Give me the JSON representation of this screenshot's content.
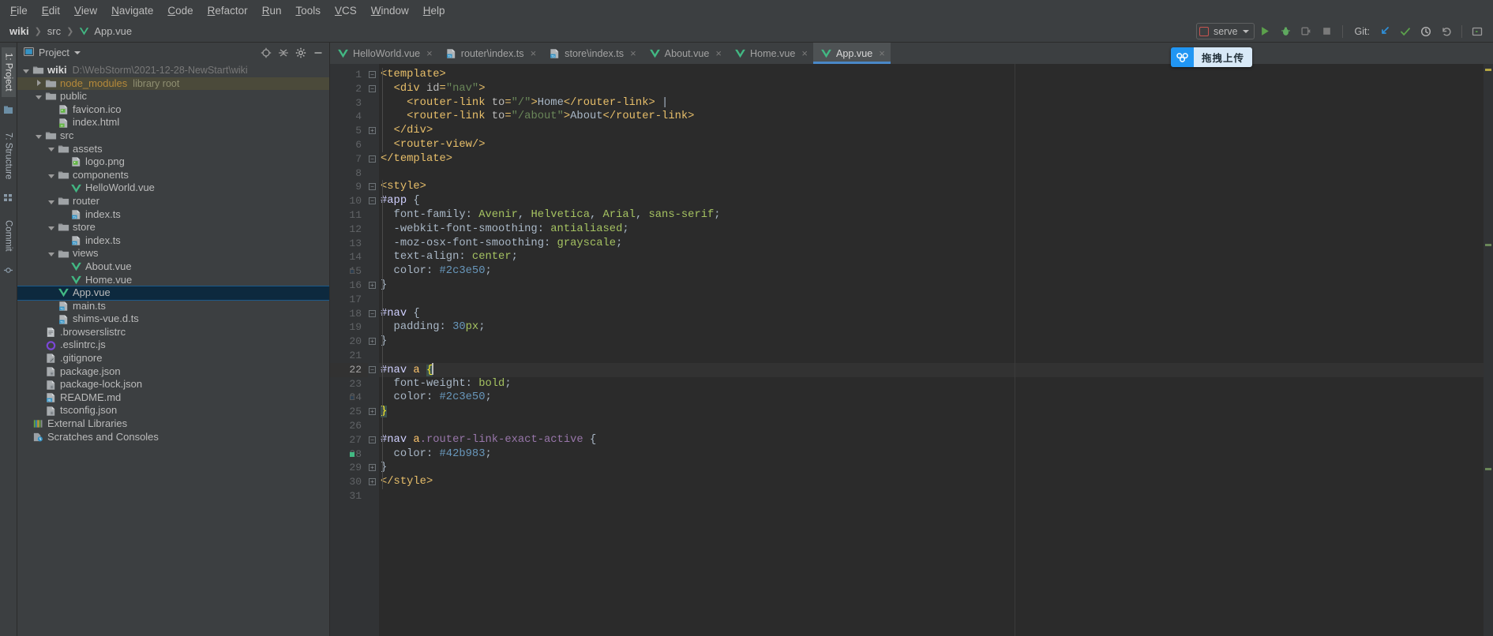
{
  "menubar": {
    "items": [
      "File",
      "Edit",
      "View",
      "Navigate",
      "Code",
      "Refactor",
      "Run",
      "Tools",
      "VCS",
      "Window",
      "Help"
    ]
  },
  "navbar": {
    "breadcrumb": [
      "wiki",
      "src",
      "App.vue"
    ],
    "breadcrumb_file_icon": "vue-icon",
    "run_config": {
      "label": "serve",
      "icon": "vue-config-icon",
      "dropdown_icon": "chevron-down-icon"
    },
    "actions": [
      {
        "name": "run-button",
        "icon": "play-icon",
        "color": "#5ca14c"
      },
      {
        "name": "debug-button",
        "icon": "bug-icon",
        "color": "#5fa95f"
      },
      {
        "name": "run-coverage-button",
        "icon": "coverage-icon",
        "color": "#7a7a7a"
      },
      {
        "name": "stop-button",
        "icon": "stop-icon",
        "color": "#7a7a7a"
      }
    ],
    "git_label": "Git:",
    "git_actions": [
      {
        "name": "update-project-button",
        "icon": "arrow-down-left-icon",
        "color": "#2f8fd6"
      },
      {
        "name": "commit-button",
        "icon": "check-icon",
        "color": "#5ca14c"
      },
      {
        "name": "history-button",
        "icon": "clock-icon",
        "color": "#b3b3b3"
      },
      {
        "name": "rollback-button",
        "icon": "undo-icon",
        "color": "#9a9a9a"
      }
    ],
    "search_everywhere_icon": "search-icon"
  },
  "left_rail": {
    "tabs": [
      {
        "label": "1: Project",
        "active": true,
        "icon": "project-icon"
      },
      {
        "label": "7: Structure",
        "active": false,
        "icon": "structure-icon"
      },
      {
        "label": "Commit",
        "active": false,
        "icon": "commit-icon"
      }
    ]
  },
  "project_panel": {
    "title": "Project",
    "dropdown_icon": "chevron-down-icon",
    "actions": [
      {
        "name": "select-opened-file-button",
        "icon": "target-icon"
      },
      {
        "name": "collapse-all-button",
        "icon": "collapse-icon"
      },
      {
        "name": "settings-button",
        "icon": "gear-icon"
      },
      {
        "name": "hide-button",
        "icon": "minus-icon"
      }
    ],
    "tree": [
      {
        "depth": 0,
        "arrow": "down",
        "icon": "folder-icon",
        "label": "wiki",
        "bold": true,
        "sub": "D:\\WebStorm\\2021-12-28-NewStart\\wiki"
      },
      {
        "depth": 1,
        "arrow": "right",
        "icon": "folder-icon",
        "label": "node_modules",
        "lib": true,
        "sub": "library root",
        "highlighted": true
      },
      {
        "depth": 1,
        "arrow": "down",
        "icon": "folder-icon",
        "label": "public"
      },
      {
        "depth": 2,
        "arrow": "none",
        "icon": "image-file-icon",
        "label": "favicon.ico"
      },
      {
        "depth": 2,
        "arrow": "none",
        "icon": "html-file-icon",
        "label": "index.html"
      },
      {
        "depth": 1,
        "arrow": "down",
        "icon": "folder-icon",
        "label": "src"
      },
      {
        "depth": 2,
        "arrow": "down",
        "icon": "folder-icon",
        "label": "assets"
      },
      {
        "depth": 3,
        "arrow": "none",
        "icon": "image-file-icon",
        "label": "logo.png"
      },
      {
        "depth": 2,
        "arrow": "down",
        "icon": "folder-icon",
        "label": "components"
      },
      {
        "depth": 3,
        "arrow": "none",
        "icon": "vue-file-icon",
        "label": "HelloWorld.vue"
      },
      {
        "depth": 2,
        "arrow": "down",
        "icon": "folder-icon",
        "label": "router"
      },
      {
        "depth": 3,
        "arrow": "none",
        "icon": "ts-file-icon",
        "label": "index.ts"
      },
      {
        "depth": 2,
        "arrow": "down",
        "icon": "folder-icon",
        "label": "store"
      },
      {
        "depth": 3,
        "arrow": "none",
        "icon": "ts-file-icon",
        "label": "index.ts"
      },
      {
        "depth": 2,
        "arrow": "down",
        "icon": "folder-icon",
        "label": "views"
      },
      {
        "depth": 3,
        "arrow": "none",
        "icon": "vue-file-icon",
        "label": "About.vue"
      },
      {
        "depth": 3,
        "arrow": "none",
        "icon": "vue-file-icon",
        "label": "Home.vue"
      },
      {
        "depth": 2,
        "arrow": "none",
        "icon": "vue-file-icon",
        "label": "App.vue",
        "selected": true
      },
      {
        "depth": 2,
        "arrow": "none",
        "icon": "ts-file-icon",
        "label": "main.ts"
      },
      {
        "depth": 2,
        "arrow": "none",
        "icon": "ts-file-icon",
        "label": "shims-vue.d.ts"
      },
      {
        "depth": 1,
        "arrow": "none",
        "icon": "text-file-icon",
        "label": ".browserslistrc"
      },
      {
        "depth": 1,
        "arrow": "none",
        "icon": "eslint-file-icon",
        "label": ".eslintrc.js"
      },
      {
        "depth": 1,
        "arrow": "none",
        "icon": "git-file-icon",
        "label": ".gitignore"
      },
      {
        "depth": 1,
        "arrow": "none",
        "icon": "json-file-icon",
        "label": "package.json"
      },
      {
        "depth": 1,
        "arrow": "none",
        "icon": "json-file-icon",
        "label": "package-lock.json"
      },
      {
        "depth": 1,
        "arrow": "none",
        "icon": "md-file-icon",
        "label": "README.md"
      },
      {
        "depth": 1,
        "arrow": "none",
        "icon": "json-file-icon",
        "label": "tsconfig.json"
      },
      {
        "depth": 0,
        "arrow": "none",
        "icon": "libraries-icon",
        "label": "External Libraries"
      },
      {
        "depth": 0,
        "arrow": "none",
        "icon": "scratches-icon",
        "label": "Scratches and Consoles"
      }
    ]
  },
  "editor": {
    "tabs": [
      {
        "label": "HelloWorld.vue",
        "icon": "vue-file-icon",
        "active": false
      },
      {
        "label": "router\\index.ts",
        "icon": "ts-file-icon",
        "active": false
      },
      {
        "label": "store\\index.ts",
        "icon": "ts-file-icon",
        "active": false
      },
      {
        "label": "About.vue",
        "icon": "vue-file-icon",
        "active": false
      },
      {
        "label": "Home.vue",
        "icon": "vue-file-icon",
        "active": false
      },
      {
        "label": "App.vue",
        "icon": "vue-file-icon",
        "active": true
      }
    ],
    "close_icon": "close-icon",
    "cursor_line": 22,
    "total_lines": 31,
    "line_numbers": [
      1,
      2,
      3,
      4,
      5,
      6,
      7,
      8,
      9,
      10,
      11,
      12,
      13,
      14,
      15,
      16,
      17,
      18,
      19,
      20,
      21,
      22,
      23,
      24,
      25,
      26,
      27,
      28,
      29,
      30,
      31
    ],
    "lines": [
      {
        "n": 1,
        "text": "<template>"
      },
      {
        "n": 2,
        "text": "  <div id=\"nav\">"
      },
      {
        "n": 3,
        "text": "    <router-link to=\"/\">Home</router-link> |"
      },
      {
        "n": 4,
        "text": "    <router-link to=\"/about\">About</router-link>"
      },
      {
        "n": 5,
        "text": "  </div>"
      },
      {
        "n": 6,
        "text": "  <router-view/>"
      },
      {
        "n": 7,
        "text": "</template>"
      },
      {
        "n": 8,
        "text": ""
      },
      {
        "n": 9,
        "text": "<style>"
      },
      {
        "n": 10,
        "text": "#app {"
      },
      {
        "n": 11,
        "text": "  font-family: Avenir, Helvetica, Arial, sans-serif;"
      },
      {
        "n": 12,
        "text": "  -webkit-font-smoothing: antialiased;"
      },
      {
        "n": 13,
        "text": "  -moz-osx-font-smoothing: grayscale;"
      },
      {
        "n": 14,
        "text": "  text-align: center;"
      },
      {
        "n": 15,
        "text": "  color: #2c3e50;"
      },
      {
        "n": 16,
        "text": "}"
      },
      {
        "n": 17,
        "text": ""
      },
      {
        "n": 18,
        "text": "#nav {"
      },
      {
        "n": 19,
        "text": "  padding: 30px;"
      },
      {
        "n": 20,
        "text": "}"
      },
      {
        "n": 21,
        "text": ""
      },
      {
        "n": 22,
        "text": "#nav a {"
      },
      {
        "n": 23,
        "text": "  font-weight: bold;"
      },
      {
        "n": 24,
        "text": "  color: #2c3e50;"
      },
      {
        "n": 25,
        "text": "}"
      },
      {
        "n": 26,
        "text": ""
      },
      {
        "n": 27,
        "text": "#nav a.router-link-exact-active {"
      },
      {
        "n": 28,
        "text": "  color: #42b983;"
      },
      {
        "n": 29,
        "text": "}"
      },
      {
        "n": 30,
        "text": "</style>"
      },
      {
        "n": 31,
        "text": ""
      }
    ]
  },
  "upload_badge": {
    "text": "拖拽上传",
    "icon": "cloud-upload-icon",
    "accent": "#2196f3"
  },
  "colors": {
    "background": "#3c3f41",
    "editor_background": "#2b2b2b",
    "gutter_background": "#313335",
    "selection": "#0d293e",
    "tab_underline": "#4a88c7",
    "tag": "#e8bf6a",
    "string": "#6a8759",
    "number": "#6897bb",
    "text": "#a9b7c6",
    "vue_green": "#42b883"
  }
}
